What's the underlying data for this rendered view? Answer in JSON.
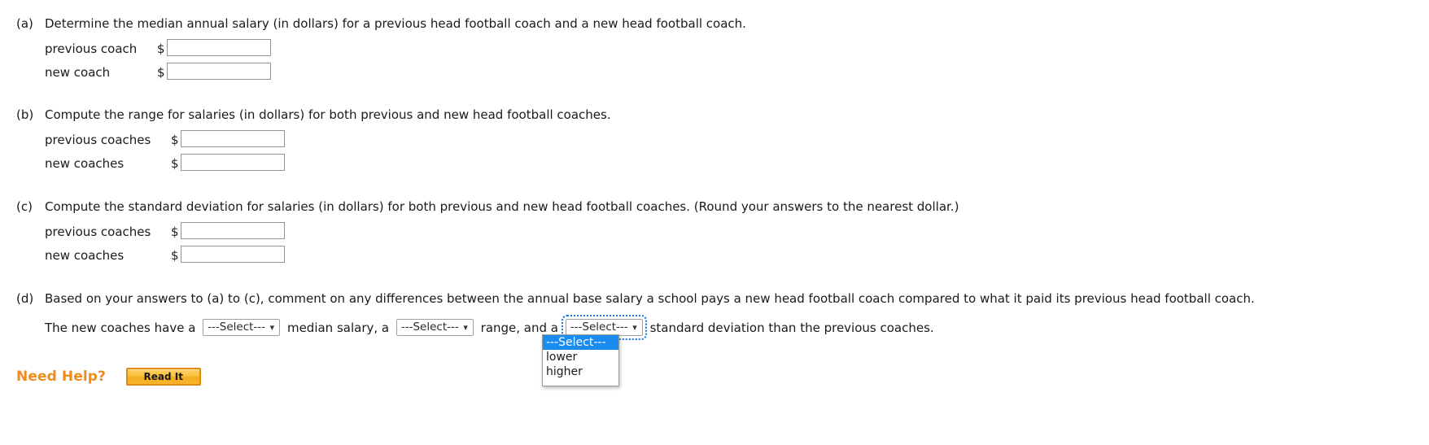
{
  "parts": [
    {
      "letter": "(a)",
      "prompt": "Determine the median annual salary (in dollars) for a previous head football coach and a new head football coach.",
      "rows": [
        {
          "label": "previous coach",
          "currency": "$",
          "value": "",
          "placeholder": ""
        },
        {
          "label": "new coach",
          "currency": "$",
          "value": "",
          "placeholder": ""
        }
      ]
    },
    {
      "letter": "(b)",
      "prompt": "Compute the range for salaries (in dollars) for both previous and new head football coaches.",
      "rows": [
        {
          "label": "previous coaches",
          "currency": "$",
          "value": "",
          "placeholder": ""
        },
        {
          "label": "new coaches",
          "currency": "$",
          "value": "",
          "placeholder": ""
        }
      ]
    },
    {
      "letter": "(c)",
      "prompt": "Compute the standard deviation for salaries (in dollars) for both previous and new head football coaches. (Round your answers to the nearest dollar.)",
      "rows": [
        {
          "label": "previous coaches",
          "currency": "$",
          "value": "",
          "placeholder": ""
        },
        {
          "label": "new coaches",
          "currency": "$",
          "value": "",
          "placeholder": ""
        }
      ]
    },
    {
      "letter": "(d)",
      "prompt": "Based on your answers to (a) to (c), comment on any differences between the annual base salary a school pays a new head football coach compared to what it paid its previous head football coach.",
      "rows": []
    }
  ],
  "sentence": {
    "fragment_1": "The new coaches have a",
    "fragment_2": "median salary, a",
    "fragment_3": "range, and a",
    "fragment_4": "standard deviation than the previous coaches.",
    "select_1": {
      "value": "---Select---",
      "caret": "⌄"
    },
    "select_2": {
      "value": "---Select---",
      "caret": "⌄"
    },
    "select_3": {
      "value": "---Select---",
      "caret": "⌄"
    }
  },
  "dropdown": {
    "open": true,
    "options": [
      "---Select---",
      "lower",
      "higher"
    ],
    "selected_index": 0
  },
  "need_help": {
    "label": "Need Help?",
    "button_label": "Read It"
  },
  "colors": {
    "need_help_orange": "#f08a1b",
    "button_border": "#e08a14",
    "dropdown_highlight": "#1a8cf0",
    "focus_ring": "#1a73e8",
    "input_border": "#949494"
  }
}
